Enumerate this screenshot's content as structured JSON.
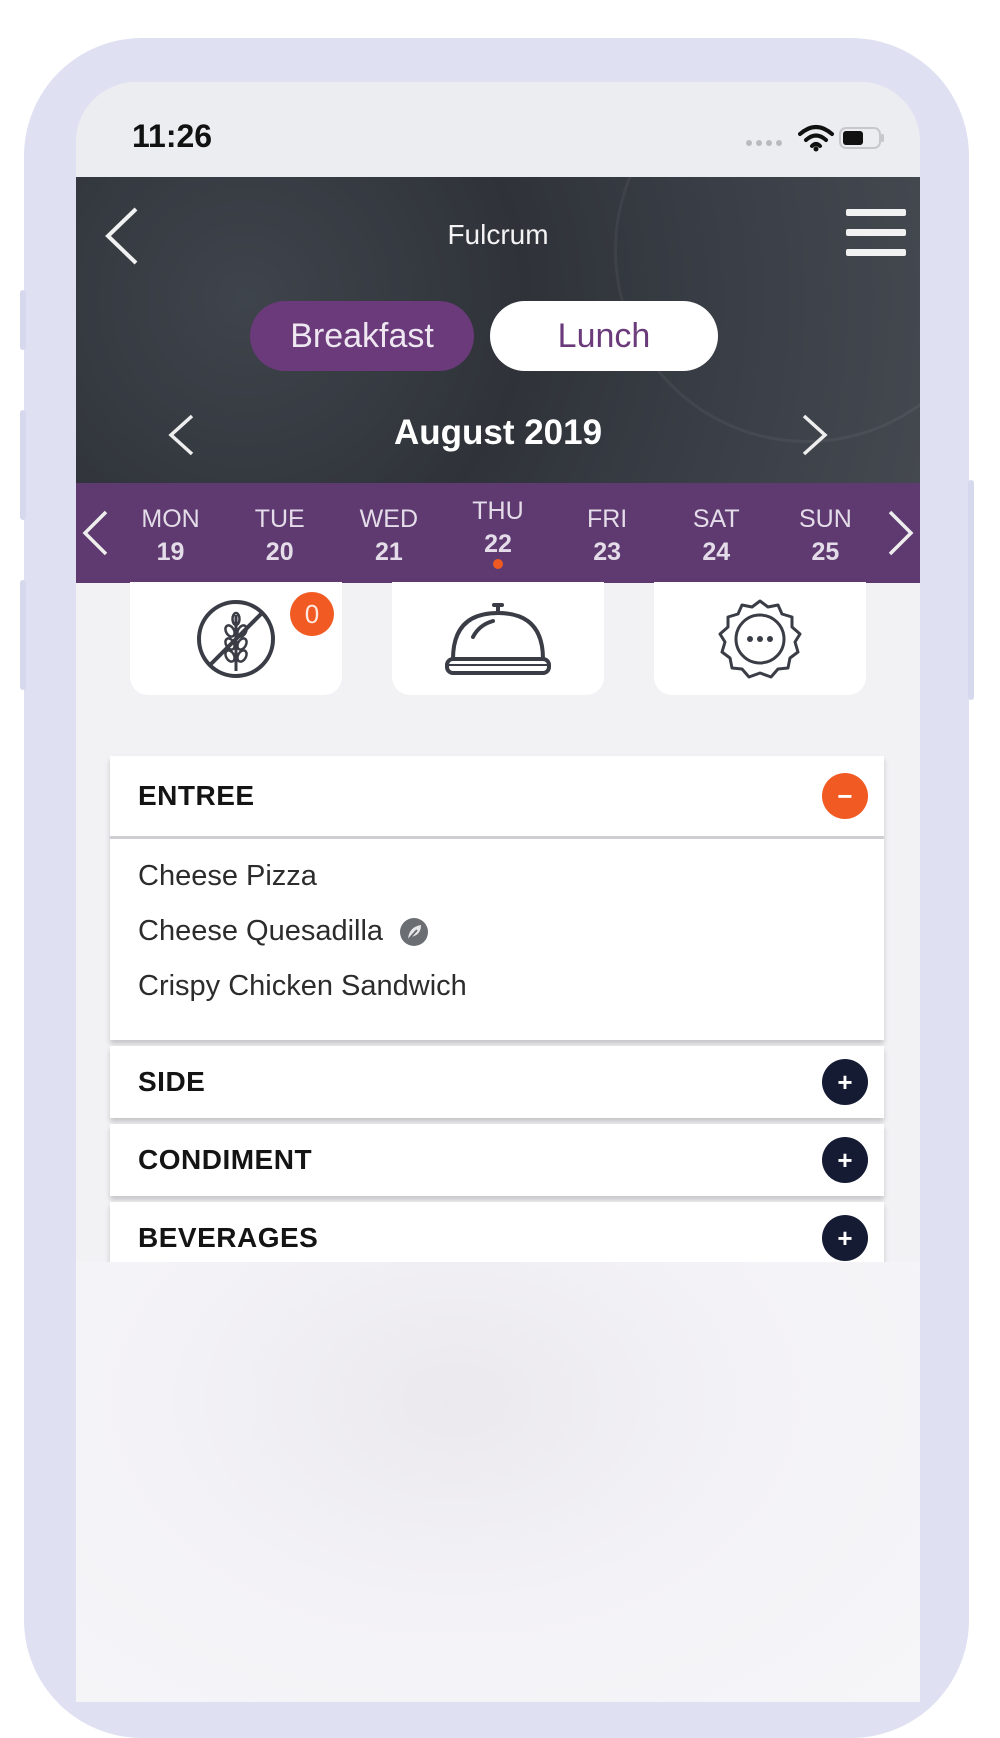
{
  "status_bar": {
    "time": "11:26",
    "wifi_icon": "wifi-icon",
    "battery_icon": "battery-icon"
  },
  "header": {
    "title": "Fulcrum",
    "back_icon": "chevron-left-icon",
    "menu_icon": "hamburger-menu-icon",
    "meal_tabs": [
      {
        "label": "Breakfast",
        "selected": false
      },
      {
        "label": "Lunch",
        "selected": true
      }
    ],
    "month": "August 2019"
  },
  "week": {
    "days": [
      {
        "dow": "MON",
        "dom": "19"
      },
      {
        "dow": "TUE",
        "dom": "20"
      },
      {
        "dow": "WED",
        "dom": "21"
      },
      {
        "dow": "THU",
        "dom": "22",
        "selected": true
      },
      {
        "dow": "FRI",
        "dom": "23"
      },
      {
        "dow": "SAT",
        "dom": "24"
      },
      {
        "dow": "SUN",
        "dom": "25"
      }
    ]
  },
  "tiles": [
    {
      "icon": "gluten-free-icon",
      "badge": "0"
    },
    {
      "icon": "cloche-icon"
    },
    {
      "icon": "more-options-badge-icon"
    }
  ],
  "menu": {
    "sections": [
      {
        "title": "ENTREE",
        "expanded": true,
        "toggle": "−",
        "items": [
          {
            "name": "Cheese Pizza"
          },
          {
            "name": "Cheese Quesadilla",
            "icon": "vegetarian-icon"
          },
          {
            "name": "Crispy Chicken Sandwich"
          }
        ]
      },
      {
        "title": "SIDE",
        "expanded": false,
        "toggle": "+"
      },
      {
        "title": "CONDIMENT",
        "expanded": false,
        "toggle": "+"
      },
      {
        "title": "BEVERAGES",
        "expanded": false,
        "toggle": "+"
      }
    ]
  },
  "colors": {
    "brand_purple": "#6a3a7a",
    "week_bar": "#5e3a70",
    "accent_orange": "#f15a22",
    "navy": "#151b33"
  }
}
